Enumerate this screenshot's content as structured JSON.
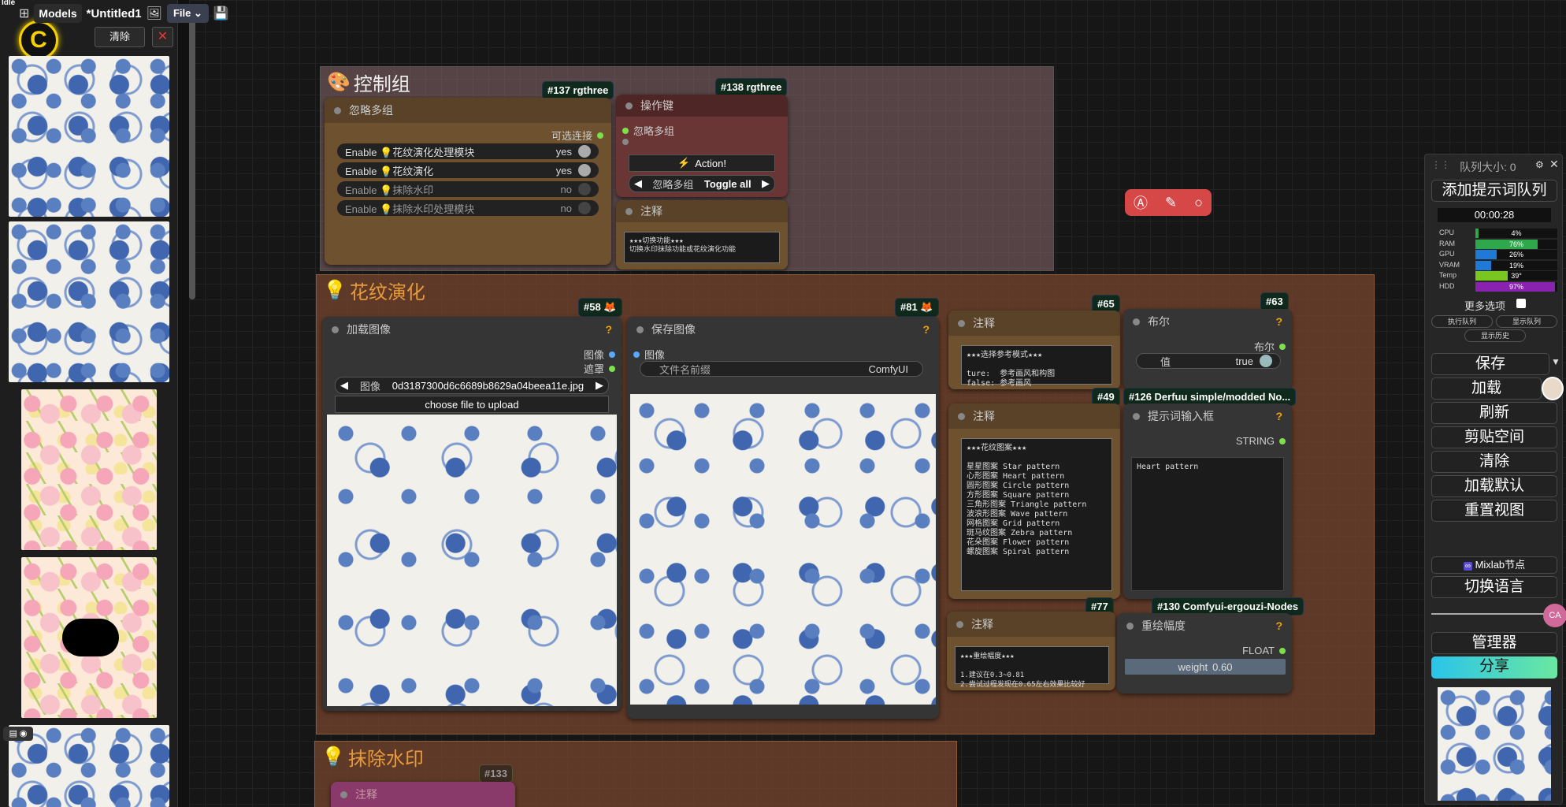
{
  "topbar": {
    "status": "Idle",
    "models": "Models",
    "title": "*Untitled1",
    "file": "File"
  },
  "sidebar": {
    "clear": "清除",
    "close": "✕",
    "logo": "C"
  },
  "groups": {
    "control": "控制组",
    "flower": "花纹演化",
    "watermark": "抹除水印"
  },
  "nodes": {
    "ignore_multi": {
      "title": "忽略多组",
      "optional": "可选连接",
      "rows": [
        {
          "label": "Enable 💡花纹演化处理模块",
          "value": "yes"
        },
        {
          "label": "Enable 💡花纹演化",
          "value": "yes"
        },
        {
          "label": "Enable 💡抹除水印",
          "value": "no"
        },
        {
          "label": "Enable 💡抹除水印处理模块",
          "value": "no"
        }
      ]
    },
    "action_key": {
      "title": "操作键",
      "input": "忽略多组",
      "action": "Action!",
      "left": "忽略多组",
      "right": "Toggle all"
    },
    "note_ctrl": {
      "title": "注释",
      "text": "★★★切换功能★★★\n切换水印抹除功能或花纹演化功能"
    },
    "load_image": {
      "title": "加载图像",
      "out1": "图像",
      "out2": "遮罩",
      "file_label": "图像",
      "file": "0d3187300d6c6689b8629a04beea11e.jpg",
      "upload": "choose file to upload"
    },
    "save_image": {
      "title": "保存图像",
      "in": "图像",
      "prefix_label": "文件名前缀",
      "prefix": "ComfyUI"
    },
    "note_ref": {
      "title": "注释",
      "text": "★★★选择参考模式★★★\n\nture:  参考画风和构图\nfalse: 参考画风"
    },
    "bool": {
      "title": "布尔",
      "out": "布尔",
      "label": "值",
      "value": "true"
    },
    "note_patterns": {
      "title": "注释",
      "text": "★★★花纹图案★★★\n\n星星图案 Star pattern\n心形图案 Heart pattern\n圆形图案 Circle pattern\n方形图案 Square pattern\n三角形图案 Triangle pattern\n波浪形图案 Wave pattern\n网格图案 Grid pattern\n斑马纹图案 Zebra pattern\n花朵图案 Flower pattern\n螺旋图案 Spiral pattern"
    },
    "prompt": {
      "title": "提示词输入框",
      "out": "STRING",
      "text": "Heart pattern"
    },
    "note_weight": {
      "title": "注释",
      "text": "★★★重绘幅度★★★\n\n1.建议在0.3~0.81\n2.尝试过程发现在0.65左右效果比较好"
    },
    "weight": {
      "title": "重绘幅度",
      "out": "FLOAT",
      "label": "weight",
      "value": "0.60"
    },
    "note_water": {
      "title": "注释"
    }
  },
  "badges": {
    "b137": "#137 rgthree",
    "b138": "#138 rgthree",
    "b58": "#58",
    "b81": "#81",
    "b65": "#65",
    "b63": "#63",
    "b49": "#49",
    "b126": "#126 Derfuu simple/modded No...",
    "b77": "#77",
    "b130": "#130 Comfyui-ergouzi-Nodes",
    "b133": "#133"
  },
  "panel": {
    "queue": "队列大小: 0",
    "add": "添加提示词队列",
    "timer": "00:00:28",
    "stats": [
      {
        "label": "CPU",
        "value": "4%",
        "pct": 4,
        "color": "#2ea84a"
      },
      {
        "label": "RAM",
        "value": "76%",
        "pct": 76,
        "color": "#2ea84a"
      },
      {
        "label": "GPU",
        "value": "26%",
        "pct": 26,
        "color": "#1e7ad6"
      },
      {
        "label": "VRAM",
        "value": "19%",
        "pct": 19,
        "color": "#1e7ad6"
      },
      {
        "label": "Temp",
        "value": "39°",
        "pct": 39,
        "color": "#7ac620"
      },
      {
        "label": "HDD",
        "value": "97%",
        "pct": 97,
        "color": "#8a22b0"
      }
    ],
    "more": "更多选项",
    "exec": "执行队列",
    "show_q": "显示队列",
    "history": "显示历史",
    "save": "保存",
    "load": "加载",
    "refresh": "刷新",
    "clipspace": "剪贴空间",
    "clear": "清除",
    "load_default": "加载默认",
    "reset_view": "重置视图",
    "mixlab": "Mixlab节点",
    "lang": "切换语言",
    "manager": "管理器",
    "share": "分享",
    "avatar_ca": "CA"
  }
}
